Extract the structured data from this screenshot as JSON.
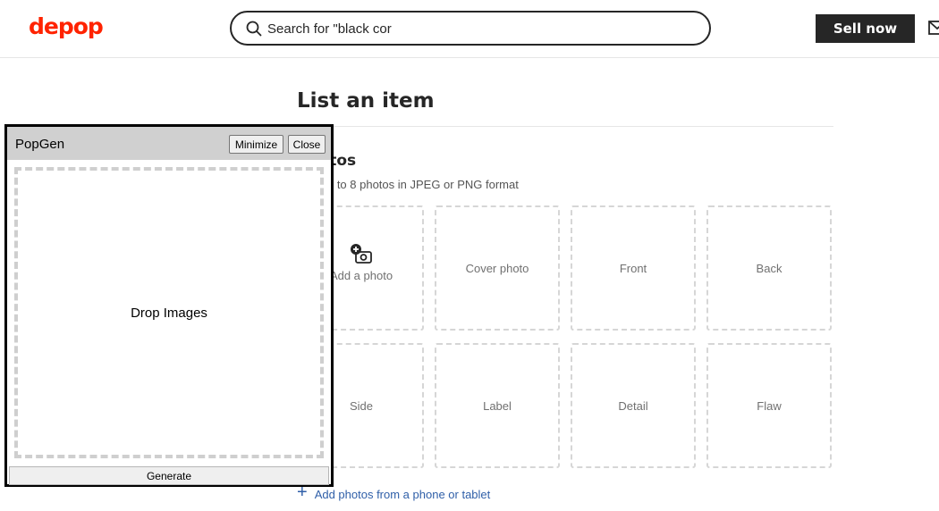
{
  "header": {
    "logo": "depop",
    "search": {
      "value": "Search for \"black cor",
      "placeholder": "Search for \"black cor"
    },
    "sell_label": "Sell now"
  },
  "form": {
    "title": "List an item",
    "photos": {
      "section_title": "Photos",
      "subtitle": "Add up to 8 photos in JPEG or PNG format",
      "add_label": "Add a photo",
      "slots": [
        "Cover photo",
        "Front",
        "Back",
        "Side",
        "Label",
        "Detail",
        "Flaw"
      ],
      "add_link": "Add photos from a phone or tablet"
    }
  },
  "popgen": {
    "title": "PopGen",
    "minimize_label": "Minimize",
    "close_label": "Close",
    "drop_label": "Drop Images",
    "generate_label": "Generate"
  },
  "colors": {
    "brand": "#ff2300",
    "dark": "#262626",
    "link": "#2f5fa8"
  }
}
